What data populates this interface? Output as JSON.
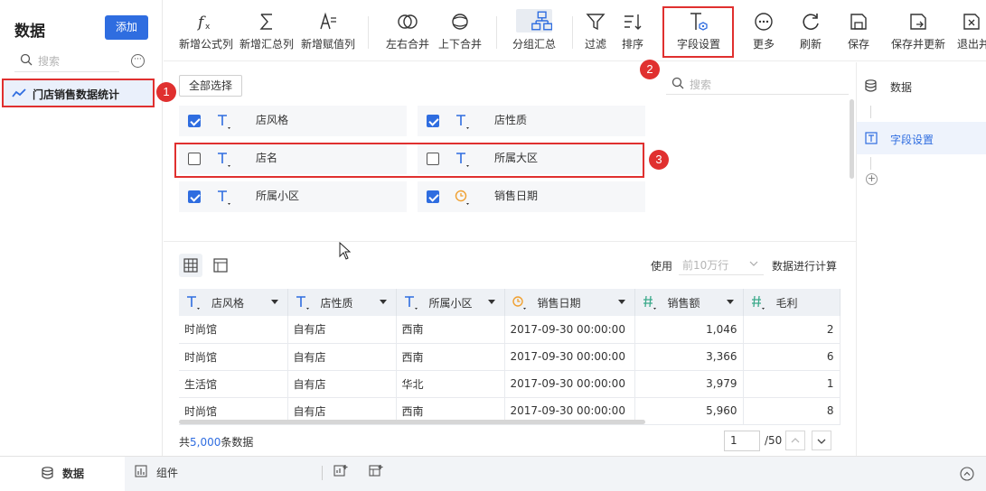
{
  "left": {
    "title": "数据",
    "add_label": "添加",
    "search_placeholder": "搜索",
    "more_label": "···",
    "items": [
      {
        "label": "门店销售数据统计"
      }
    ]
  },
  "toolbar": {
    "buttons": [
      {
        "label": "新增公式列",
        "icon": "fx-icon"
      },
      {
        "label": "新增汇总列",
        "icon": "sigma-icon"
      },
      {
        "label": "新增赋值列",
        "icon": "assign-icon"
      },
      {
        "label": "左右合并",
        "icon": "merge-horizontal-icon"
      },
      {
        "label": "上下合并",
        "icon": "merge-vertical-icon"
      },
      {
        "label": "分组汇总",
        "icon": "group-summary-icon"
      },
      {
        "label": "过滤",
        "icon": "filter-icon"
      },
      {
        "label": "排序",
        "icon": "sort-icon"
      },
      {
        "label": "字段设置",
        "icon": "field-settings-icon"
      },
      {
        "label": "更多",
        "icon": "more-icon"
      },
      {
        "label": "刷新",
        "icon": "refresh-icon"
      },
      {
        "label": "保存",
        "icon": "save-icon"
      },
      {
        "label": "保存并更新",
        "icon": "save-update-icon"
      },
      {
        "label": "退出并",
        "icon": "exit-icon"
      }
    ]
  },
  "fields": {
    "select_all_label": "全部选择",
    "search_placeholder": "搜索",
    "items": [
      {
        "name": "店风格",
        "checked": true,
        "type": "text"
      },
      {
        "name": "店性质",
        "checked": true,
        "type": "text"
      },
      {
        "name": "店名",
        "checked": false,
        "type": "text"
      },
      {
        "name": "所属大区",
        "checked": false,
        "type": "text"
      },
      {
        "name": "所属小区",
        "checked": true,
        "type": "text"
      },
      {
        "name": "销售日期",
        "checked": true,
        "type": "date"
      }
    ]
  },
  "right_panel": {
    "items": [
      {
        "label": "数据",
        "icon": "database-icon",
        "selected": false
      },
      {
        "label": "字段设置",
        "icon": "field-settings-icon",
        "selected": true
      }
    ],
    "add_label": "+"
  },
  "preview": {
    "use_label": "使用",
    "rows_select": "前10万行",
    "calc_label": "数据进行计算",
    "columns": [
      {
        "name": "店风格",
        "type": "text"
      },
      {
        "name": "店性质",
        "type": "text"
      },
      {
        "name": "所属小区",
        "type": "text"
      },
      {
        "name": "销售日期",
        "type": "date"
      },
      {
        "name": "销售额",
        "type": "number"
      },
      {
        "name": "毛利",
        "type": "number"
      }
    ],
    "rows": [
      [
        "时尚馆",
        "自有店",
        "西南",
        "2017-09-30 00:00:00",
        "1,046",
        "2"
      ],
      [
        "时尚馆",
        "自有店",
        "西南",
        "2017-09-30 00:00:00",
        "3,366",
        "6"
      ],
      [
        "生活馆",
        "自有店",
        "华北",
        "2017-09-30 00:00:00",
        "3,979",
        "1"
      ],
      [
        "时尚馆",
        "自有店",
        "西南",
        "2017-09-30 00:00:00",
        "5,960",
        "8"
      ]
    ],
    "total_prefix": "共",
    "total_count": "5,000",
    "total_suffix": "条数据",
    "page_current": "1",
    "page_total": "/50"
  },
  "annotations": [
    "1",
    "2",
    "3"
  ],
  "bottom": {
    "tab_data": "数据",
    "tab_component": "组件"
  },
  "colors": {
    "accent": "#2f6de0",
    "highlight": "#e0302f",
    "date_icon": "#f0a030",
    "number_icon": "#3aa98a"
  }
}
